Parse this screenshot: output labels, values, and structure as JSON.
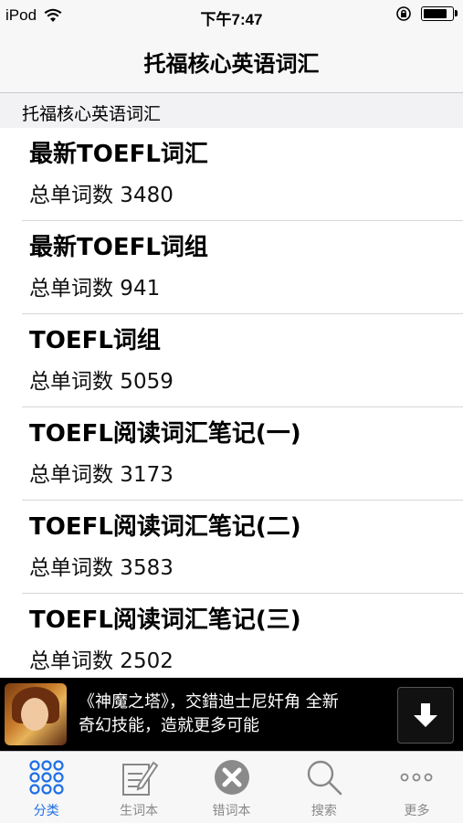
{
  "status_bar": {
    "carrier": "iPod",
    "time": "下午7:47",
    "battery_level": 0.9
  },
  "nav": {
    "title": "托福核心英语词汇"
  },
  "section": {
    "title": "托福核心英语词汇"
  },
  "list": [
    {
      "title": "最新TOEFL词汇",
      "subtitle": "总单词数 3480"
    },
    {
      "title": "最新TOEFL词组",
      "subtitle": "总单词数 941"
    },
    {
      "title": "TOEFL词组",
      "subtitle": "总单词数 5059"
    },
    {
      "title": "TOEFL阅读词汇笔记(一)",
      "subtitle": "总单词数 3173"
    },
    {
      "title": "TOEFL阅读词汇笔记(二)",
      "subtitle": "总单词数 3583"
    },
    {
      "title": "TOEFL阅读词汇笔记(三)",
      "subtitle": "总单词数 2502"
    }
  ],
  "ad": {
    "line1": "《神魔之塔》，交錯迪士尼奸角 全新",
    "line2": "奇幻技能，造就更多可能",
    "icon": "download-arrow-icon"
  },
  "tabs": [
    {
      "label": "分类",
      "icon": "grid-dots-icon",
      "active": true
    },
    {
      "label": "生词本",
      "icon": "notebook-pen-icon",
      "active": false
    },
    {
      "label": "错词本",
      "icon": "close-circle-icon",
      "active": false
    },
    {
      "label": "搜索",
      "icon": "search-icon",
      "active": false
    },
    {
      "label": "更多",
      "icon": "more-dots-icon",
      "active": false
    }
  ],
  "colors": {
    "accent": "#1f6fe6",
    "tab_inactive": "#888888",
    "ad_bg": "#000000"
  }
}
